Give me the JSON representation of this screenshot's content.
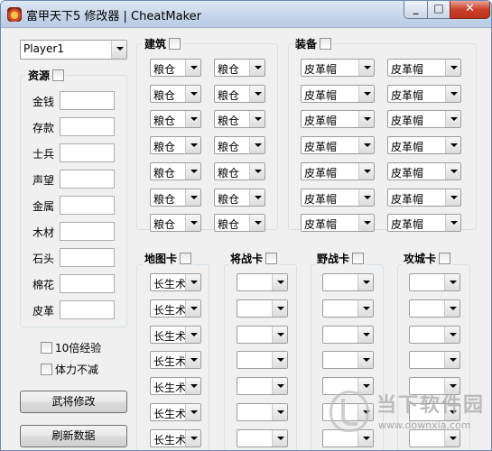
{
  "window": {
    "title": "富甲天下5 修改器 | CheatMaker",
    "minimize": "_",
    "maximize": "□",
    "close": "✕"
  },
  "player": {
    "selected": "Player1"
  },
  "resources": {
    "title": "资源",
    "fields": [
      "金钱",
      "存款",
      "士兵",
      "声望",
      "金属",
      "木材",
      "石头",
      "棉花",
      "皮革"
    ]
  },
  "options": {
    "double_exp": "10倍经验",
    "no_stamina_loss": "体力不减"
  },
  "buttons": {
    "modify_general": "武将修改",
    "refresh": "刷新数据"
  },
  "buildings": {
    "title": "建筑",
    "value": "粮仓"
  },
  "equipment": {
    "title": "装备",
    "value": "皮革帽"
  },
  "map_cards": {
    "title": "地图卡",
    "value": "长生术"
  },
  "general_cards": {
    "title": "将战卡",
    "value": ""
  },
  "field_cards": {
    "title": "野战卡",
    "value": ""
  },
  "siege_cards": {
    "title": "攻城卡",
    "value": ""
  },
  "watermark": {
    "text": "当下软件园",
    "url": "www.downxia.com"
  }
}
